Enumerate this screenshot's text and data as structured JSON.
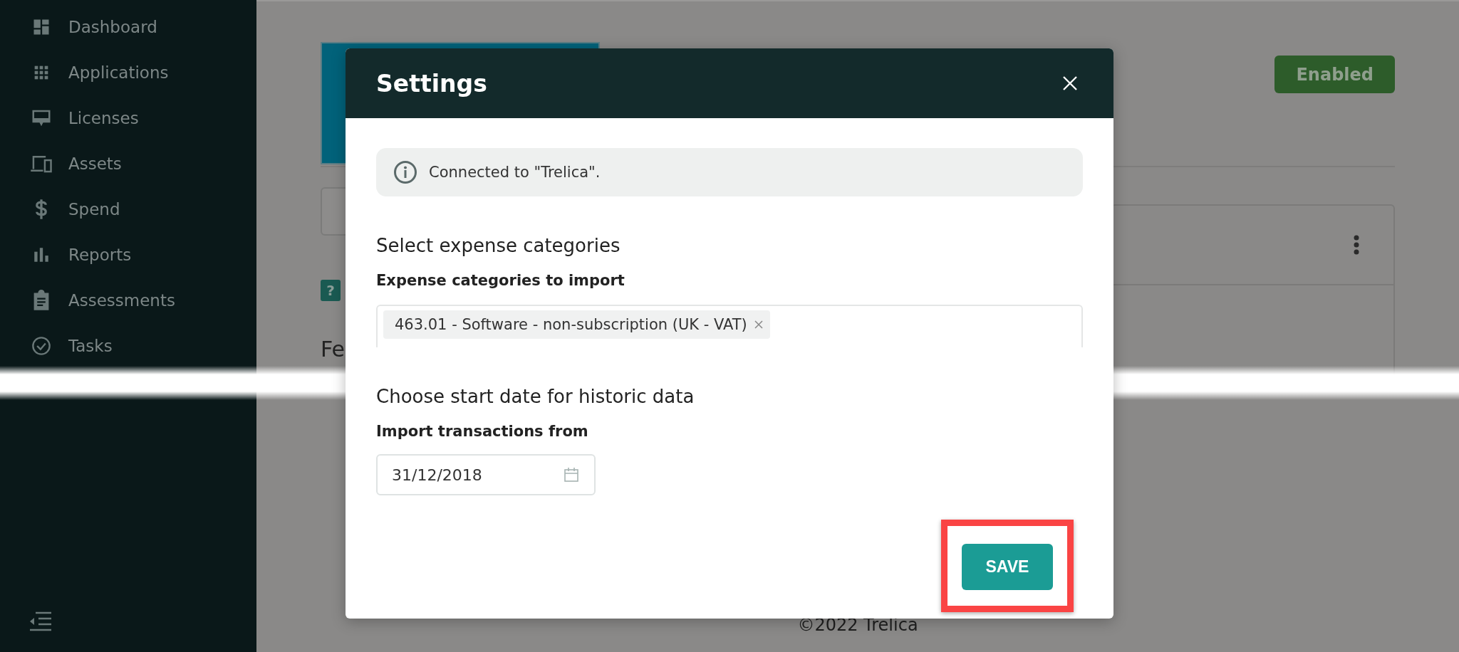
{
  "sidebar": {
    "items": [
      {
        "label": "Dashboard"
      },
      {
        "label": "Applications"
      },
      {
        "label": "Licenses"
      },
      {
        "label": "Assets"
      },
      {
        "label": "Spend"
      },
      {
        "label": "Reports"
      },
      {
        "label": "Assessments"
      },
      {
        "label": "Tasks"
      }
    ]
  },
  "page": {
    "status_button": "Enabled",
    "help_badge": "?",
    "partial_heading": "Fe",
    "footer": "©2022 Trelica"
  },
  "dialog": {
    "title": "Settings",
    "notice": "Connected to \"Trelica\".",
    "sections": [
      {
        "kind": "multiselect",
        "heading": "Select expense categories",
        "label": "Expense categories to import",
        "chips": [
          "463.01 - Software - non-subscription (UK - VAT)"
        ]
      },
      {
        "kind": "date",
        "heading": "Choose start date for historic data",
        "label": "Import transactions from",
        "value": "31/12/2018"
      }
    ],
    "button": "SAVE"
  }
}
